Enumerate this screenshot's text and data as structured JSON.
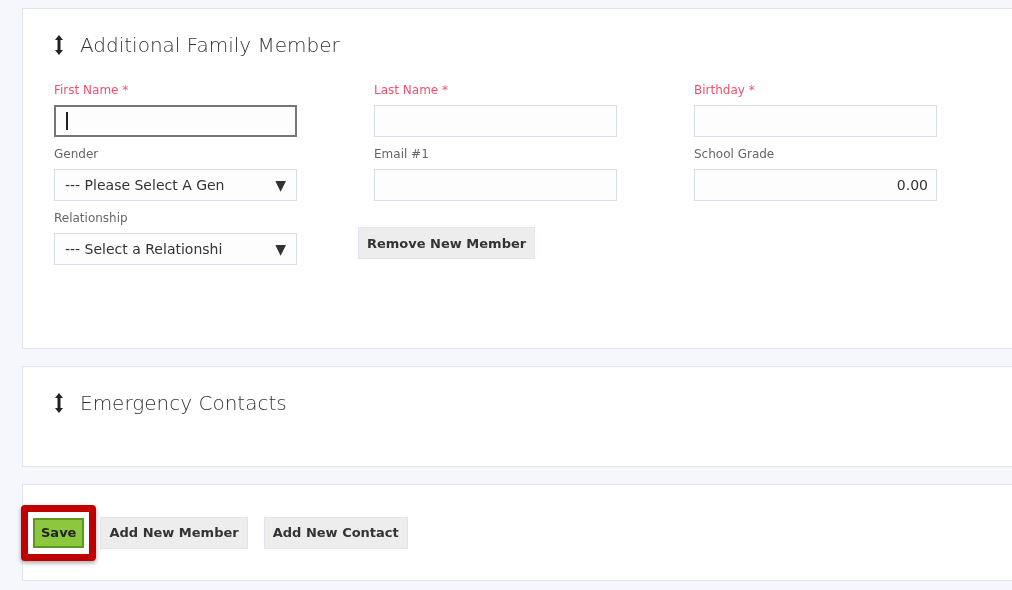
{
  "sections": [
    {
      "title": "Additional Family Member",
      "fields": [
        {
          "label": "First Name *",
          "required": true,
          "kind": "text",
          "focused": true
        },
        {
          "label": "Last Name *",
          "required": true,
          "kind": "text",
          "focused": false
        },
        {
          "label": "Birthday *",
          "required": true,
          "kind": "text",
          "focused": false
        },
        {
          "label": "Gender",
          "required": false,
          "kind": "select",
          "value": "--- Please Select A Gen",
          "caret": "▼"
        },
        {
          "label": "Email #1",
          "required": false,
          "kind": "text",
          "focused": false
        },
        {
          "label": "School Grade",
          "required": false,
          "kind": "number",
          "value": "0.00"
        },
        {
          "label": "Relationship",
          "required": false,
          "kind": "select",
          "value": "--- Select a Relationshi",
          "caret": "▼"
        },
        {
          "kind": "button",
          "label": "Remove New Member"
        }
      ]
    },
    {
      "title": "Emergency Contacts"
    }
  ],
  "actions": [
    {
      "label": "Save",
      "kind": "primary",
      "highlighted": true
    },
    {
      "label": "Add New Member",
      "kind": "secondary",
      "highlighted": false
    },
    {
      "label": "Add New Contact",
      "kind": "secondary",
      "highlighted": false
    }
  ]
}
